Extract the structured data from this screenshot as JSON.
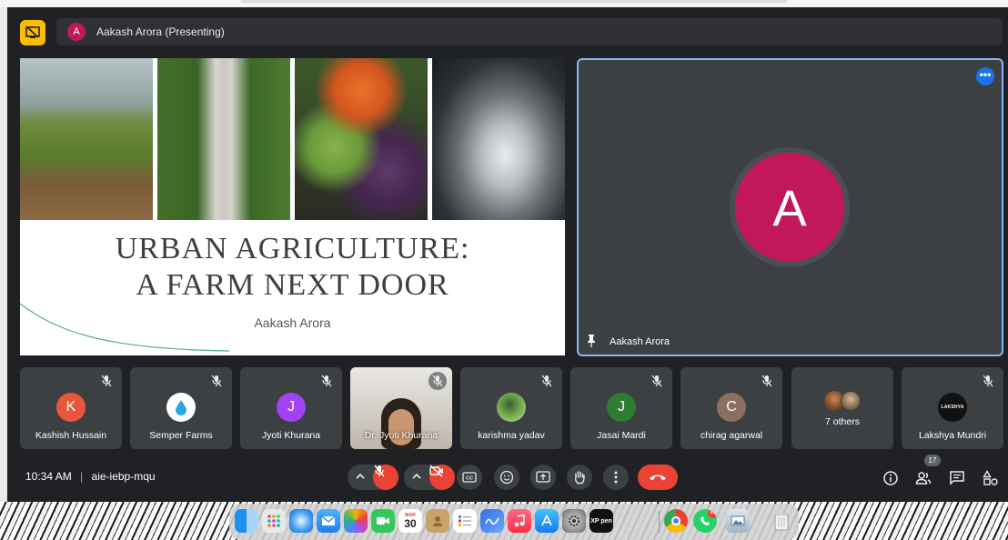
{
  "presenting_bar": {
    "avatar_letter": "A",
    "text": "Aakash Arora (Presenting)"
  },
  "slide": {
    "title_line1": "URBAN AGRICULTURE:",
    "title_line2": "A FARM NEXT DOOR",
    "author": "Aakash Arora"
  },
  "main_tile": {
    "avatar_letter": "A",
    "name": "Aakash Arora",
    "more_label": "•••"
  },
  "participants": [
    {
      "name": "Kashish Hussain",
      "letter": "K",
      "color": "#e8573c"
    },
    {
      "name": "Semper Farms",
      "letter": "",
      "color": "#ffffff"
    },
    {
      "name": "Jyoti Khurana",
      "letter": "J",
      "color": "#a142f4"
    },
    {
      "name": "Dr. Jyoti Khurana",
      "letter": "",
      "color": ""
    },
    {
      "name": "karishma yadav",
      "letter": "",
      "color": "#6fa84a"
    },
    {
      "name": "Jasai Mardi",
      "letter": "J",
      "color": "#2e7d32"
    },
    {
      "name": "chirag agarwal",
      "letter": "C",
      "color": "#8d6e63"
    },
    {
      "name": "7 others",
      "letter": "",
      "color": ""
    },
    {
      "name": "Lakshya Mundri",
      "letter": "LAKSHYA",
      "color": "#111111"
    }
  ],
  "controls": {
    "time": "10:34 AM",
    "separator": "|",
    "meeting_code": "aie-iebp-mqu",
    "people_count": "17"
  },
  "dock": {
    "calendar_month": "MAR",
    "calendar_day": "30",
    "xp_pen_label": "XP pen",
    "whatsapp_badge": "10"
  },
  "colors": {
    "meet_bg": "#202124",
    "tile_bg": "#3c4043",
    "accent_blue": "#8ab4f8",
    "end_call_red": "#ea4335",
    "present_yellow": "#fbbc04"
  }
}
